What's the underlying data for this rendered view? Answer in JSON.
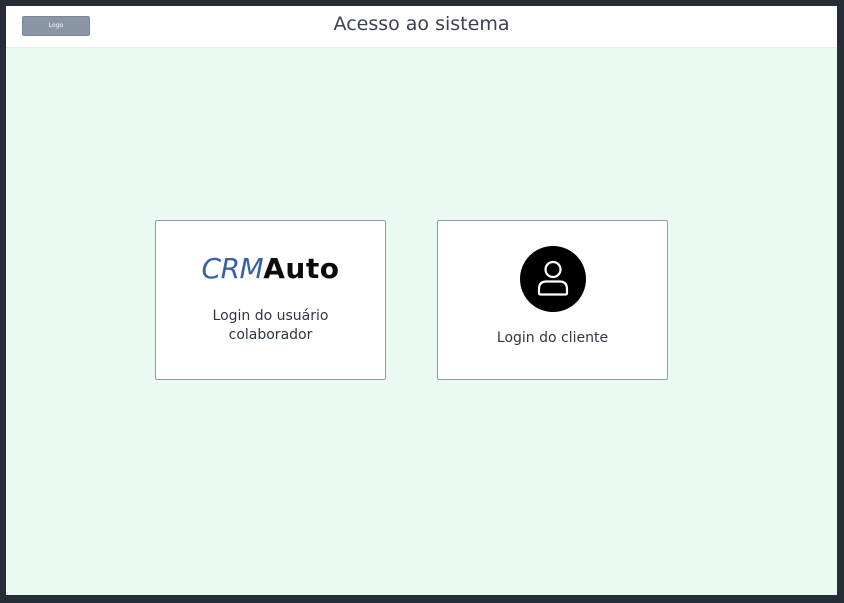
{
  "header": {
    "logo_label": "Logo",
    "title": "Acesso ao sistema"
  },
  "cards": {
    "employee": {
      "brand_prefix": "CRM",
      "brand_suffix": "Auto",
      "label": "Login do usuário colaborador"
    },
    "client": {
      "icon": "user-icon",
      "label": "Login do cliente"
    }
  },
  "colors": {
    "background": "#eafaf2",
    "topbar": "#ffffff",
    "frame": "#262d37",
    "logo_button": "#8a95a6",
    "brand_blue": "#3a5fa8",
    "card_border": "#8f9baa"
  }
}
